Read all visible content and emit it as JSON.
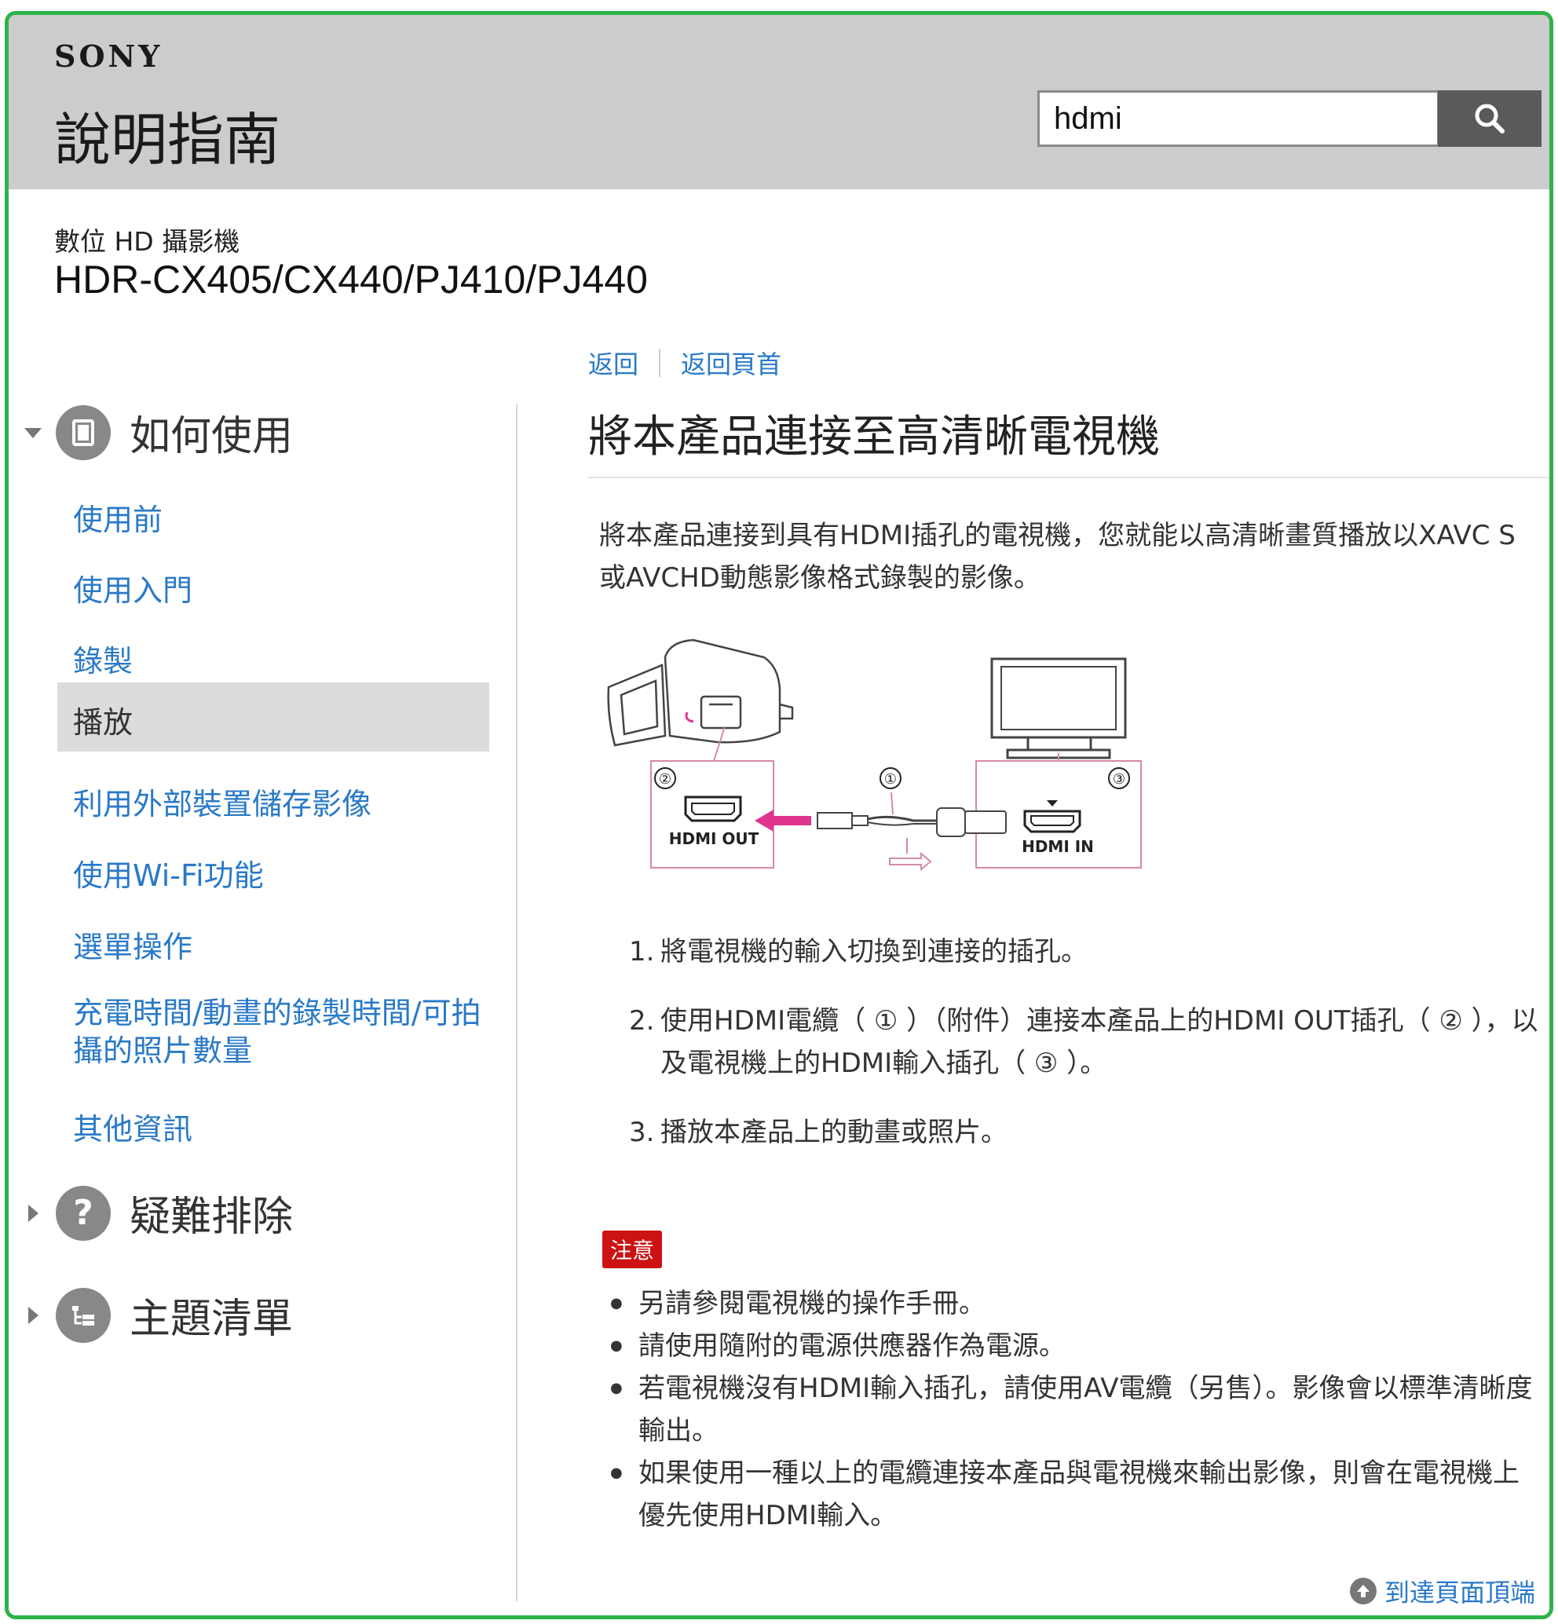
{
  "header": {
    "brand": "SONY",
    "title": "說明指南",
    "search_value": "hdmi"
  },
  "product": {
    "category": "數位 HD 攝影機",
    "model": "HDR-CX405/CX440/PJ410/PJ440"
  },
  "sidebar": {
    "sections": [
      {
        "label": "如何使用",
        "icon": "book-icon",
        "expanded": true
      },
      {
        "label": "疑難排除",
        "icon": "question-icon",
        "expanded": false
      },
      {
        "label": "主題清單",
        "icon": "list-icon",
        "expanded": false
      }
    ],
    "items": [
      {
        "label": "使用前"
      },
      {
        "label": "使用入門"
      },
      {
        "label": "錄製"
      },
      {
        "label": "播放",
        "active": true
      },
      {
        "label": "利用外部裝置儲存影像"
      },
      {
        "label": "使用Wi-Fi功能"
      },
      {
        "label": "選單操作"
      },
      {
        "label": "充電時間/動畫的錄製時間/可拍攝的照片數量"
      },
      {
        "label": "其他資訊"
      }
    ]
  },
  "breadcrumb": {
    "back": "返回",
    "home": "返回頁首"
  },
  "main": {
    "title": "將本產品連接至高清晰電視機",
    "intro": "將本產品連接到具有HDMI插孔的電視機，您就能以高清晰畫質播放以XAVC S或AVCHD動態影像格式錄製的影像。",
    "diagram": {
      "label_out": "HDMI OUT",
      "label_in": "HDMI IN",
      "markers": [
        "①",
        "②",
        "③"
      ]
    },
    "steps": [
      {
        "num": "1.",
        "text": "將電視機的輸入切換到連接的插孔。"
      },
      {
        "num": "2.",
        "text": "使用HDMI電纜（ ① ）（附件）連接本產品上的HDMI OUT插孔（ ② ），以及電視機上的HDMI輸入插孔（ ③ ）。"
      },
      {
        "num": "3.",
        "text": "播放本產品上的動畫或照片。"
      }
    ],
    "note_label": "注意",
    "notes": [
      "另請參閱電視機的操作手冊。",
      "請使用隨附的電源供應器作為電源。",
      "若電視機沒有HDMI輸入插孔，請使用AV電纜（另售）。影像會以標準清晰度輸出。",
      "如果使用一種以上的電纜連接本產品與電視機來輸出影像，則會在電視機上優先使用HDMI輸入。"
    ],
    "to_top": "到達頁面頂端"
  },
  "colors": {
    "link": "#2979c8",
    "header_bg": "#cccccc",
    "note": "#cc1212",
    "frame": "#2eb34a"
  }
}
